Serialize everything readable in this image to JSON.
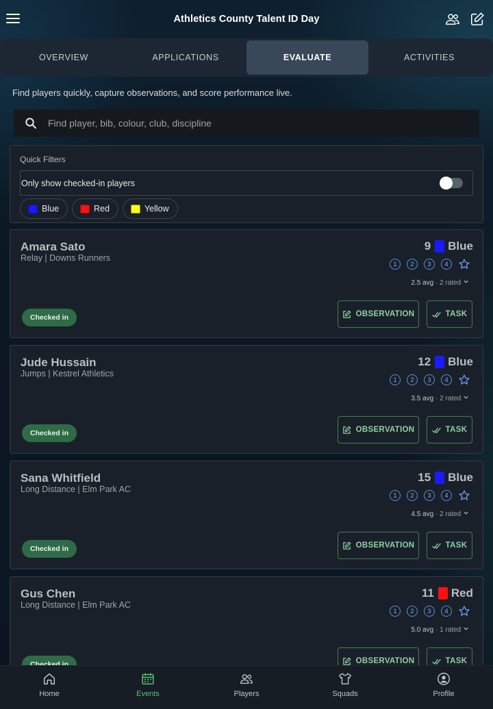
{
  "header": {
    "title": "Athletics County Talent ID Day",
    "menu_icon": "hamburger-menu-icon",
    "right_icons": [
      "people-icon",
      "edit-icon"
    ]
  },
  "tabs": [
    {
      "label": "OVERVIEW",
      "active": false
    },
    {
      "label": "APPLICATIONS",
      "active": false
    },
    {
      "label": "EVALUATE",
      "active": true
    },
    {
      "label": "ACTIVITIES",
      "active": false
    }
  ],
  "intro": "Find players quickly, capture observations, and score performance live.",
  "search": {
    "placeholder": "Find player, bib, colour, club, discipline",
    "value": ""
  },
  "filters": {
    "title": "Quick Filters",
    "checked_in_label": "Only show checked-in players",
    "checked_in_on": false,
    "chips": [
      {
        "label": "Blue",
        "color": "#1a1aff"
      },
      {
        "label": "Red",
        "color": "#ff1010"
      },
      {
        "label": "Yellow",
        "color": "#ffff1a"
      }
    ]
  },
  "rating_scale": [
    "1",
    "2",
    "3",
    "4"
  ],
  "buttons": {
    "observation": "OBSERVATION",
    "task": "TASK"
  },
  "players": [
    {
      "name": "Amara Sato",
      "meta": "Relay | Downs Runners",
      "bib": "9",
      "colour": "Blue",
      "colour_hex": "#1a1aff",
      "avg": "2.5 avg",
      "rated": "· 2 rated",
      "status": "Checked in"
    },
    {
      "name": "Jude Hussain",
      "meta": "Jumps | Kestrel Athletics",
      "bib": "12",
      "colour": "Blue",
      "colour_hex": "#1a1aff",
      "avg": "3.5 avg",
      "rated": "· 2 rated",
      "status": "Checked in"
    },
    {
      "name": "Sana Whitfield",
      "meta": "Long Distance | Elm Park AC",
      "bib": "15",
      "colour": "Blue",
      "colour_hex": "#1a1aff",
      "avg": "4.5 avg",
      "rated": "· 2 rated",
      "status": "Checked in"
    },
    {
      "name": "Gus Chen",
      "meta": "Long Distance | Elm Park AC",
      "bib": "11",
      "colour": "Red",
      "colour_hex": "#ff1010",
      "avg": "5.0 avg",
      "rated": "· 1 rated",
      "status": "Checked in"
    }
  ],
  "bottom_nav": [
    {
      "label": "Home",
      "icon": "home-icon",
      "active": false
    },
    {
      "label": "Events",
      "icon": "calendar-icon",
      "active": true
    },
    {
      "label": "Players",
      "icon": "players-icon",
      "active": false
    },
    {
      "label": "Squads",
      "icon": "shirt-icon",
      "active": false
    },
    {
      "label": "Profile",
      "icon": "profile-icon",
      "active": false
    }
  ]
}
